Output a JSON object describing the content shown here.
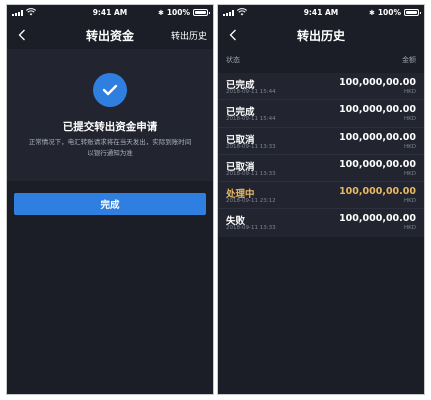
{
  "status_bar": {
    "time": "9:41 AM",
    "bluetooth": "✱",
    "battery": "100%"
  },
  "left_screen": {
    "nav": {
      "back_icon": "chevron-left-icon",
      "title": "转出资金",
      "action_label": "转出历史"
    },
    "success": {
      "icon": "check-circle-icon",
      "title": "已提交转出资金申请",
      "description": "正常情况下，电汇转账请求将在当天发出，实际到账时间以银行通知为准"
    },
    "done_label": "完成"
  },
  "right_screen": {
    "nav": {
      "back_icon": "chevron-left-icon",
      "title": "转出历史"
    },
    "list_header": {
      "status": "状态",
      "amount": "金额"
    },
    "records": [
      {
        "status": "已完成",
        "date": "2018-09-11 15:44",
        "amount": "100,000,00.00",
        "currency": "HKD",
        "highlight": false
      },
      {
        "status": "已完成",
        "date": "2018-09-11 15:44",
        "amount": "100,000,00.00",
        "currency": "HKD",
        "highlight": false
      },
      {
        "status": "已取消",
        "date": "2018-09-11 13:33",
        "amount": "100,000,00.00",
        "currency": "HKD",
        "highlight": false
      },
      {
        "status": "已取消",
        "date": "2018-09-11 13:33",
        "amount": "100,000,00.00",
        "currency": "HKD",
        "highlight": false
      },
      {
        "status": "处理中",
        "date": "2018-09-11 23:12",
        "amount": "100,000,00.00",
        "currency": "HKD",
        "highlight": true
      },
      {
        "status": "失败",
        "date": "2018-09-11 13:33",
        "amount": "100,000,00.00",
        "currency": "HKD",
        "highlight": false
      }
    ]
  },
  "colors": {
    "background": "#1b1e27",
    "panel": "#22252f",
    "accent": "#2f7fe0",
    "pending": "#e8b864"
  }
}
